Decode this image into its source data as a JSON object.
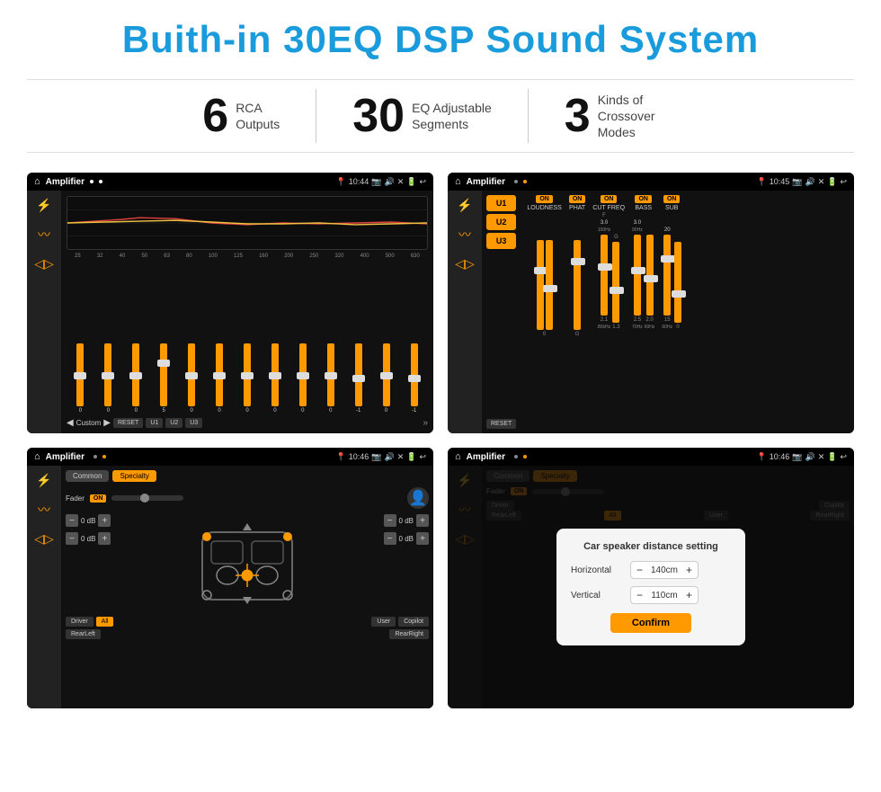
{
  "header": {
    "title": "Buith-in 30EQ DSP Sound System"
  },
  "stats": [
    {
      "number": "6",
      "text_line1": "RCA",
      "text_line2": "Outputs"
    },
    {
      "number": "30",
      "text_line1": "EQ Adjustable",
      "text_line2": "Segments"
    },
    {
      "number": "3",
      "text_line1": "Kinds of",
      "text_line2": "Crossover Modes"
    }
  ],
  "screens": [
    {
      "id": "eq-screen",
      "status_bar": {
        "app_name": "Amplifier",
        "time": "10:44"
      },
      "type": "eq"
    },
    {
      "id": "crossover-screen",
      "status_bar": {
        "app_name": "Amplifier",
        "time": "10:45"
      },
      "type": "crossover"
    },
    {
      "id": "speaker-screen",
      "status_bar": {
        "app_name": "Amplifier",
        "time": "10:46"
      },
      "type": "speaker"
    },
    {
      "id": "distance-screen",
      "status_bar": {
        "app_name": "Amplifier",
        "time": "10:46"
      },
      "type": "distance-dialog",
      "dialog": {
        "title": "Car speaker distance setting",
        "horizontal_label": "Horizontal",
        "horizontal_value": "140cm",
        "vertical_label": "Vertical",
        "vertical_value": "110cm",
        "confirm_label": "Confirm"
      }
    }
  ],
  "eq": {
    "frequencies": [
      "25",
      "32",
      "40",
      "50",
      "63",
      "80",
      "100",
      "125",
      "160",
      "200",
      "250",
      "320",
      "400",
      "500",
      "630"
    ],
    "values": [
      "0",
      "0",
      "0",
      "5",
      "0",
      "0",
      "0",
      "0",
      "0",
      "0",
      "-1",
      "0",
      "-1"
    ],
    "preset": "Custom",
    "buttons": [
      "RESET",
      "U1",
      "U2",
      "U3"
    ]
  },
  "crossover": {
    "presets": [
      "U1",
      "U2",
      "U3"
    ],
    "columns": [
      {
        "on": true,
        "label": "LOUDNESS"
      },
      {
        "on": true,
        "label": "PHAT"
      },
      {
        "on": true,
        "label": "CUT FREQ"
      },
      {
        "on": true,
        "label": "BASS"
      },
      {
        "on": true,
        "label": "SUB"
      }
    ],
    "reset_label": "RESET"
  },
  "speaker": {
    "tabs": [
      "Common",
      "Specialty"
    ],
    "active_tab": "Specialty",
    "fader_label": "Fader",
    "on_label": "ON",
    "db_values": [
      "0 dB",
      "0 dB",
      "0 dB",
      "0 dB"
    ],
    "bottom_btns": [
      "Driver",
      "All",
      "User",
      "RearLeft",
      "RearRight",
      "Copilot"
    ]
  },
  "dialog": {
    "title": "Car speaker distance setting",
    "horizontal_label": "Horizontal",
    "horizontal_value": "140cm",
    "vertical_label": "Vertical",
    "vertical_value": "110cm",
    "confirm_label": "Confirm"
  }
}
